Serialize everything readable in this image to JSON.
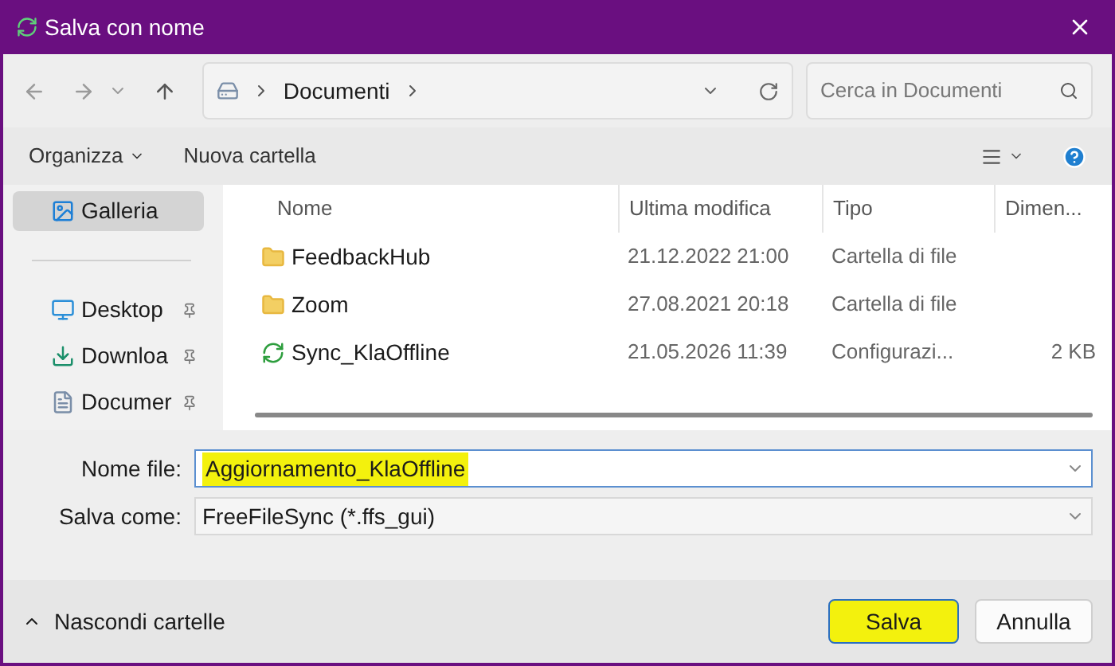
{
  "window": {
    "title": "Salva con nome"
  },
  "address": {
    "location": "Documenti",
    "search_placeholder": "Cerca in Documenti"
  },
  "toolbar": {
    "organize": "Organizza",
    "new_folder": "Nuova cartella"
  },
  "sidebar": {
    "items": [
      {
        "label": "Galleria",
        "kind": "gallery",
        "selected": true,
        "pinned": false
      },
      {
        "label": "Desktop",
        "kind": "desktop",
        "selected": false,
        "pinned": true
      },
      {
        "label": "Downloa",
        "kind": "download",
        "selected": false,
        "pinned": true
      },
      {
        "label": "Documer",
        "kind": "document",
        "selected": false,
        "pinned": true
      }
    ]
  },
  "table": {
    "columns": [
      "Nome",
      "Ultima modifica",
      "Tipo",
      "Dimen..."
    ],
    "rows": [
      {
        "kind": "folder",
        "name": "FeedbackHub",
        "modified": "21.12.2022 21:00",
        "type": "Cartella di file",
        "size": ""
      },
      {
        "kind": "folder",
        "name": "Zoom",
        "modified": "27.08.2021 20:18",
        "type": "Cartella di file",
        "size": ""
      },
      {
        "kind": "sync",
        "name": "Sync_KlaOffline",
        "modified": "21.05.2026 11:39",
        "type": "Configurazi...",
        "size": "2 KB"
      }
    ]
  },
  "form": {
    "file_name_label": "Nome file:",
    "file_name": "Aggiornamento_KlaOffline",
    "file_name_highlighted": true,
    "save_as_label": "Salva come:",
    "save_as": "FreeFileSync (*.ffs_gui)"
  },
  "footer": {
    "hide_folders": "Nascondi cartelle",
    "save": "Salva",
    "save_highlighted": true,
    "cancel": "Annulla"
  }
}
